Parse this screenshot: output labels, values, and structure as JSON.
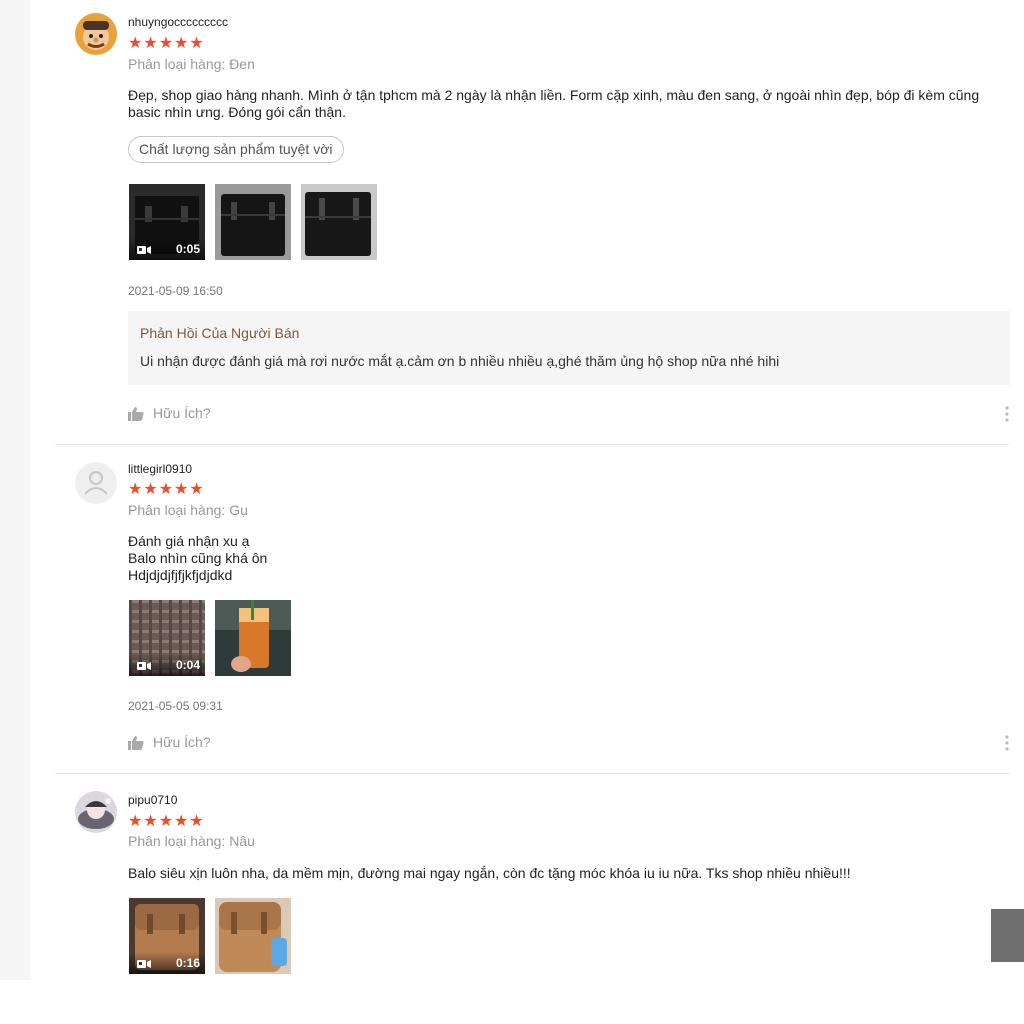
{
  "reviews": [
    {
      "username": "nhuyngoccccccccc",
      "stars": "★★★★★",
      "variant": "Phân loại hàng: Đen",
      "comment": "Đẹp, shop giao hàng nhanh. Mình ở tận tphcm mà 2 ngày là nhận liền. Form cặp xinh, màu đen sang, ở ngoài nhìn đẹp, bóp đi kèm cũng basic nhìn ưng. Đóng gói cẩn thận.",
      "tag": "Chất lượng sản phẩm tuyệt vời",
      "video_duration": "0:05",
      "timestamp": "2021-05-09 16:50",
      "seller_reply_title": "Phản Hồi Của Người Bán",
      "seller_reply_text": "Ui nhận được đánh giá mà rơi nước mắt ạ.cảm ơn b nhiều nhiều ạ,ghé thăm ủng hộ shop nữa nhé hihi",
      "helpful_label": "Hữu Ích?"
    },
    {
      "username": "littlegirl0910",
      "stars": "★★★★★",
      "variant": "Phân loại hàng: Gụ",
      "comment": "Đánh giá nhận xu ạ\nBalo nhìn cũng khá ôn\nHdjdjdjfjfjkfjdjdkd",
      "video_duration": "0:04",
      "timestamp": "2021-05-05 09:31",
      "helpful_label": "Hữu Ích?"
    },
    {
      "username": "pipu0710",
      "stars": "★★★★★",
      "variant": "Phân loại hàng: Nâu",
      "comment": "Balo siêu xịn luôn nha, da mềm mịn, đường mai ngay ngắn, còn đc tặng móc khóa iu iu nữa. Tks shop nhiều nhiều!!!",
      "video_duration": "0:16"
    }
  ],
  "colors": {
    "star": "#ee4d2d",
    "seller_title": "#7d5a3c",
    "seller_bg": "#f5f5f5",
    "muted": "#999999"
  },
  "icons": [
    "video-camera-icon",
    "thumbs-up-icon",
    "more-vertical-icon",
    "default-user-icon"
  ]
}
